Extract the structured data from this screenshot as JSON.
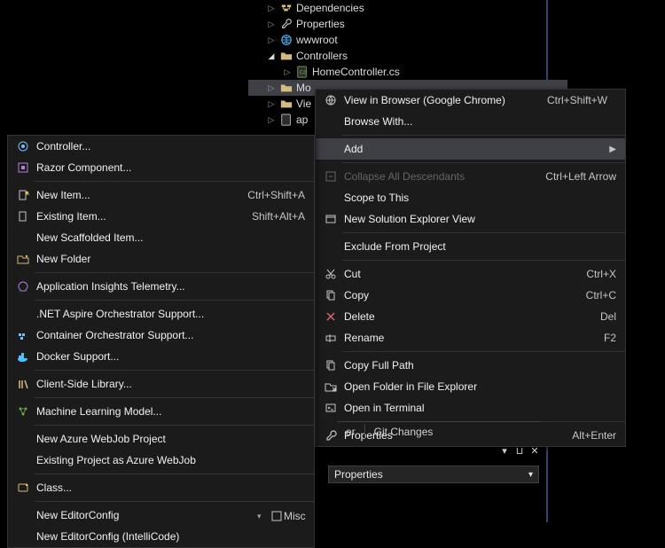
{
  "tree": {
    "dependencies": "Dependencies",
    "properties": "Properties",
    "wwwroot": "wwwroot",
    "controllers": "Controllers",
    "homecontroller": "HomeController.cs",
    "models_visible": "Mo",
    "views_visible": "Vie",
    "appsettings_visible": "ap"
  },
  "ctx": {
    "view_in_browser": "View in Browser (Google Chrome)",
    "view_in_browser_key": "Ctrl+Shift+W",
    "browse_with": "Browse With...",
    "add": "Add",
    "collapse_all": "Collapse All Descendants",
    "collapse_all_key": "Ctrl+Left Arrow",
    "scope_to_this": "Scope to This",
    "new_explorer_view": "New Solution Explorer View",
    "exclude_from_project": "Exclude From Project",
    "cut": "Cut",
    "cut_key": "Ctrl+X",
    "copy": "Copy",
    "copy_key": "Ctrl+C",
    "delete": "Delete",
    "delete_key": "Del",
    "rename": "Rename",
    "rename_key": "F2",
    "copy_full_path": "Copy Full Path",
    "open_folder": "Open Folder in File Explorer",
    "open_terminal": "Open in Terminal",
    "properties": "Properties",
    "properties_key": "Alt+Enter"
  },
  "sub": {
    "controller": "Controller...",
    "razor_component": "Razor Component...",
    "new_item": "New Item...",
    "new_item_key": "Ctrl+Shift+A",
    "existing_item": "Existing Item...",
    "existing_item_key": "Shift+Alt+A",
    "new_scaffolded": "New Scaffolded Item...",
    "new_folder": "New Folder",
    "app_insights": "Application Insights Telemetry...",
    "aspire": ".NET Aspire Orchestrator Support...",
    "container_orch": "Container Orchestrator Support...",
    "docker": "Docker Support...",
    "client_lib": "Client-Side Library...",
    "ml_model": "Machine Learning Model...",
    "azure_webjob_new": "New Azure WebJob Project",
    "azure_webjob_existing": "Existing Project as Azure WebJob",
    "class": "Class...",
    "editorconfig": "New EditorConfig",
    "editorconfig_ai": "New EditorConfig (IntelliCode)"
  },
  "bottom": {
    "tab_suffix": "er",
    "git_changes": "Git Changes",
    "properties_dropdown": "Properties",
    "misc": "Misc"
  }
}
